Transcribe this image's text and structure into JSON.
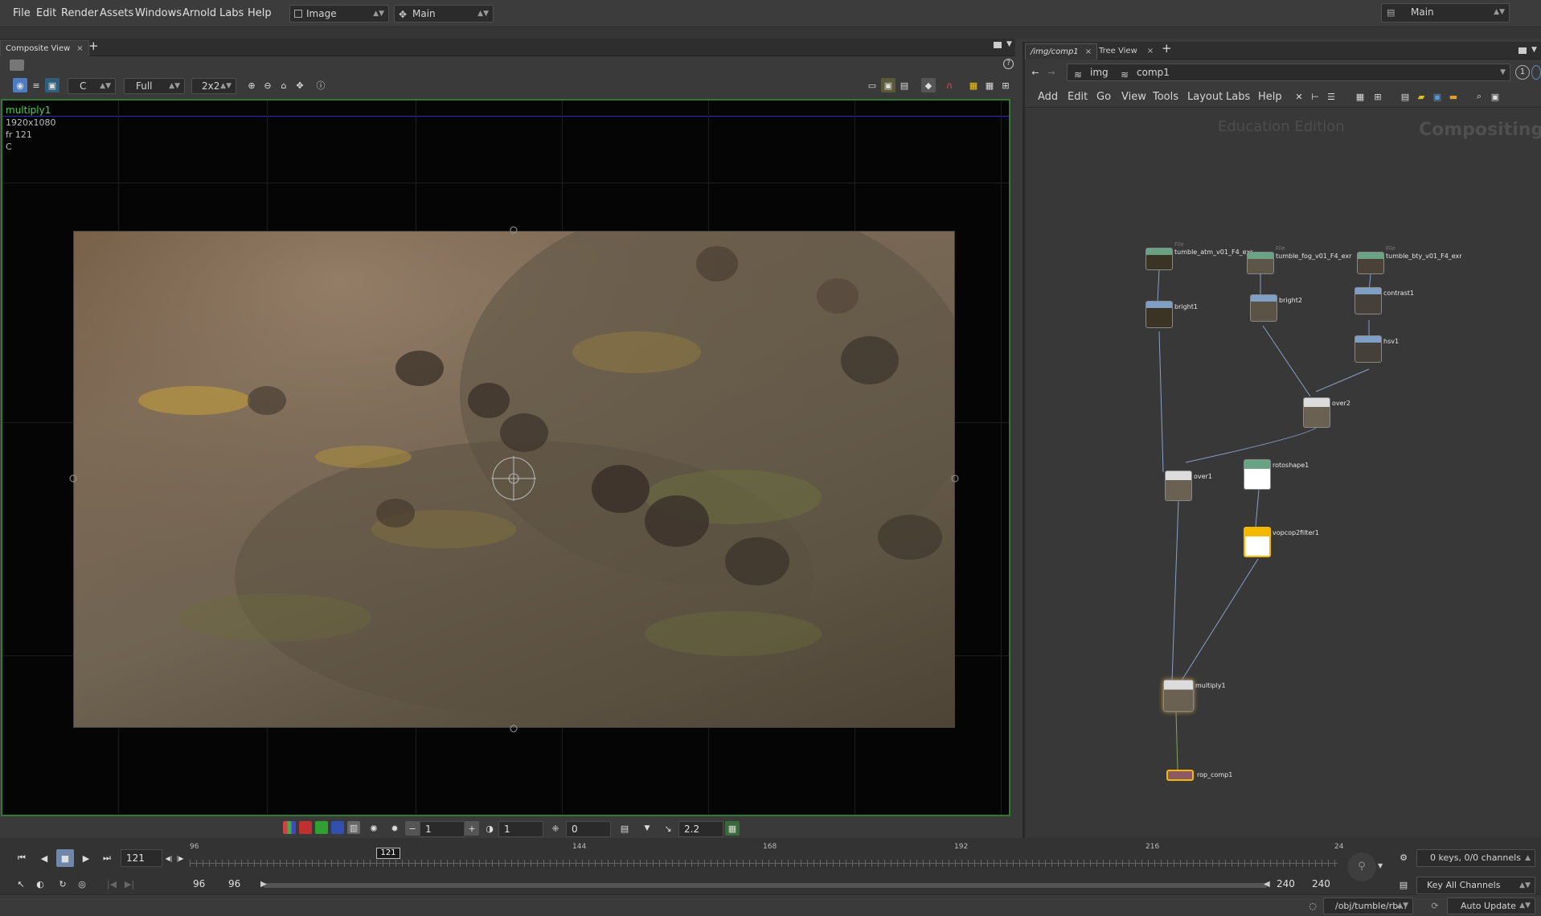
{
  "menu": {
    "items": [
      "File",
      "Edit",
      "Render",
      "Assets",
      "Windows",
      "Arnold",
      "Labs",
      "Help"
    ],
    "desk_dropdown": "Image",
    "main_dropdown": "Main",
    "right_dropdown": "Main"
  },
  "left_panel": {
    "tab_label": "Composite View",
    "toolbar": {
      "plane": "C",
      "resolution": "Full",
      "proxy": "2x2"
    },
    "viewer": {
      "node_name": "multiply1",
      "image_size": "1920x1080",
      "frame": "fr 121",
      "plane": "C"
    },
    "bottom_bar": {
      "value1": "1",
      "value2": "1",
      "value3": "0",
      "gamma": "2.2"
    }
  },
  "right_panel": {
    "tabs": [
      "/img/comp1",
      "Tree View"
    ],
    "path": {
      "level1": "img",
      "level2": "comp1"
    },
    "menu": [
      "Add",
      "Edit",
      "Go",
      "View",
      "Tools",
      "Layout",
      "Labs",
      "Help"
    ],
    "watermark_left": "Education Edition",
    "watermark_right": "Compositing",
    "nodes": [
      {
        "name": "tumble_atm_v01_F4_exr",
        "type": "File",
        "kind": "file"
      },
      {
        "name": "tumble_fog_v01_F4_exr",
        "type": "File",
        "kind": "file"
      },
      {
        "name": "tumble_bty_v01_F4_exr",
        "type": "File",
        "kind": "file"
      },
      {
        "name": "bright1",
        "type": "",
        "kind": "filter"
      },
      {
        "name": "bright2",
        "type": "",
        "kind": "filter"
      },
      {
        "name": "contrast1",
        "type": "",
        "kind": "filter"
      },
      {
        "name": "hsv1",
        "type": "",
        "kind": "filter"
      },
      {
        "name": "over2",
        "type": "",
        "kind": "merge"
      },
      {
        "name": "over1",
        "type": "",
        "kind": "merge"
      },
      {
        "name": "rotoshape1",
        "type": "",
        "kind": "roto"
      },
      {
        "name": "vopcop2filter1",
        "type": "",
        "kind": "vop"
      },
      {
        "name": "multiply1",
        "type": "",
        "kind": "merge"
      },
      {
        "name": "rop_comp1",
        "type": "",
        "kind": "rop"
      }
    ]
  },
  "timeline": {
    "current_frame": "121",
    "frame_marker": "121",
    "ticks": [
      "96",
      "144",
      "168",
      "192",
      "216",
      "24"
    ],
    "start": "96",
    "start2": "96",
    "end": "240",
    "end2": "240",
    "keys_status": "0 keys, 0/0 channels",
    "key_button": "Key All Channels"
  },
  "status": {
    "path": "/obj/tumble/rb...",
    "update_mode": "Auto Update"
  },
  "colors": {
    "viewer_border": "#2f7a2f",
    "node_file": "#6aa384",
    "node_filter": "#7f9fc4",
    "node_vop": "#f5b800",
    "node_rop": "#8c5a64",
    "wire": "#8aa0c8"
  }
}
